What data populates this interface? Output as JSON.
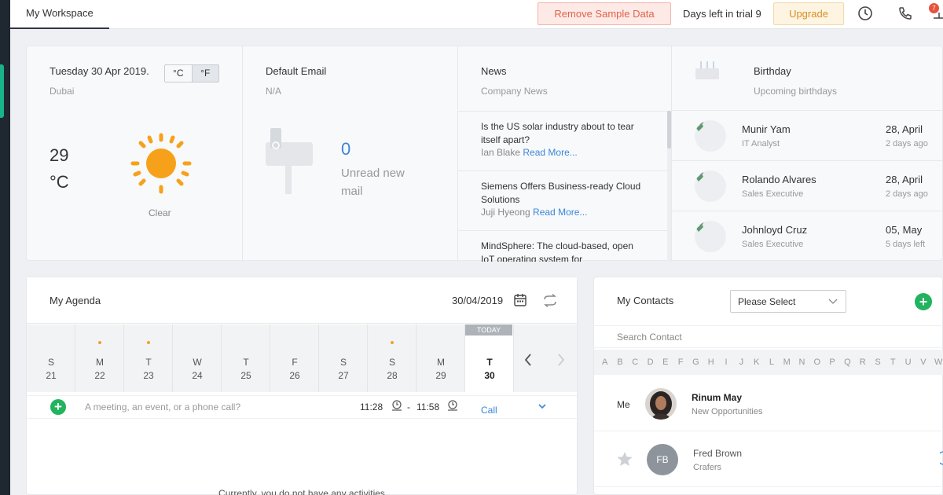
{
  "topbar": {
    "tab_workspace": "My Workspace",
    "remove_sample": "Remove Sample Data",
    "trial_text": "Days left in trial 9",
    "upgrade": "Upgrade",
    "notification_count": "7"
  },
  "weather": {
    "date": "Tuesday 30 Apr 2019.",
    "city": "Dubai",
    "unit_c": "°C",
    "unit_f": "°F",
    "temp_value": "29",
    "temp_unit": "°C",
    "condition": "Clear"
  },
  "email": {
    "title": "Default Email",
    "account": "N/A",
    "unread_count": "0",
    "unread_label": "Unread new mail"
  },
  "news": {
    "title": "News",
    "subtitle": "Company News",
    "read_more": "Read More...",
    "items": [
      {
        "headline": "Is the US solar industry about to tear itself apart?",
        "author": "Ian Blake"
      },
      {
        "headline": "Siemens Offers Business-ready Cloud Solutions",
        "author": "Juji Hyeong"
      },
      {
        "headline": "MindSphere: The cloud-based, open IoT operating system for",
        "author": ""
      }
    ]
  },
  "birthday": {
    "title": "Birthday",
    "subtitle": "Upcoming birthdays",
    "items": [
      {
        "name": "Munir Yam",
        "role": "IT Analyst",
        "date": "28, April",
        "ago": "2 days ago"
      },
      {
        "name": "Rolando Alvares",
        "role": "Sales Executive",
        "date": "28, April",
        "ago": "2 days ago"
      },
      {
        "name": "Johnloyd Cruz",
        "role": "Sales Executive",
        "date": "05, May",
        "ago": "5 days left"
      }
    ]
  },
  "agenda": {
    "title": "My Agenda",
    "date": "30/04/2019",
    "today_label": "TODAY",
    "days": [
      {
        "letter": "S",
        "num": "21",
        "dot": false
      },
      {
        "letter": "M",
        "num": "22",
        "dot": true
      },
      {
        "letter": "T",
        "num": "23",
        "dot": true
      },
      {
        "letter": "W",
        "num": "24",
        "dot": false
      },
      {
        "letter": "T",
        "num": "25",
        "dot": false
      },
      {
        "letter": "F",
        "num": "26",
        "dot": false
      },
      {
        "letter": "S",
        "num": "27",
        "dot": false
      },
      {
        "letter": "S",
        "num": "28",
        "dot": true
      },
      {
        "letter": "M",
        "num": "29",
        "dot": false
      },
      {
        "letter": "T",
        "num": "30",
        "dot": false
      }
    ],
    "input_placeholder": "A meeting, an event, or a phone call?",
    "time_start": "11:28",
    "time_sep": "-",
    "time_end": "11:58",
    "activity_type": "Call",
    "empty_text": "Currently, you do not have any activities"
  },
  "contacts": {
    "title": "My Contacts",
    "select_value": "Please Select",
    "search_placeholder": "Search Contact",
    "alphabet": [
      "A",
      "B",
      "C",
      "D",
      "E",
      "F",
      "G",
      "H",
      "I",
      "J",
      "K",
      "L",
      "M",
      "N",
      "O",
      "P",
      "Q",
      "R",
      "S",
      "T",
      "U",
      "V",
      "W"
    ],
    "me_label": "Me",
    "me_name": "Rinum May",
    "me_sub": "New Opportunities",
    "contact_name": "Fred Brown",
    "contact_company": "Crafers",
    "contact_initials": "FB"
  },
  "colors": {
    "accent_green": "#22b35e",
    "link_blue": "#3a86d9",
    "sun": "#f7a11b"
  }
}
